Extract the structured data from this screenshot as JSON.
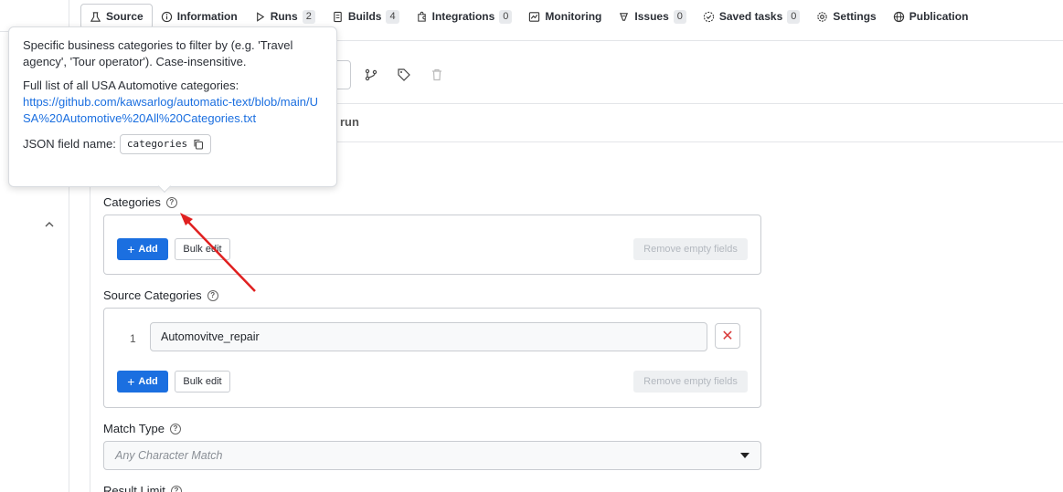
{
  "tabs": [
    {
      "label": "Source",
      "count": null,
      "icon": "source-icon"
    },
    {
      "label": "Information",
      "count": null,
      "icon": "info-icon"
    },
    {
      "label": "Runs",
      "count": "2",
      "icon": "play-icon"
    },
    {
      "label": "Builds",
      "count": "4",
      "icon": "builds-icon"
    },
    {
      "label": "Integrations",
      "count": "0",
      "icon": "puzzle-icon"
    },
    {
      "label": "Monitoring",
      "count": null,
      "icon": "chart-icon"
    },
    {
      "label": "Issues",
      "count": "0",
      "icon": "bug-icon"
    },
    {
      "label": "Saved tasks",
      "count": "0",
      "icon": "saved-tasks-icon"
    },
    {
      "label": "Settings",
      "count": null,
      "icon": "gear-icon"
    },
    {
      "label": "Publication",
      "count": null,
      "icon": "globe-icon"
    }
  ],
  "toolbar": {
    "run_text": "run"
  },
  "tooltip": {
    "description": "Specific business categories to filter by (e.g. 'Travel agency', 'Tour operator'). Case-insensitive.",
    "list_intro": "Full list of all USA Automotive categories:",
    "link": "https://github.com/kawsarlog/automatic-text/blob/main/USA%20Automotive%20All%20Categories.txt",
    "json_label": "JSON field name:",
    "json_field": "categories"
  },
  "form": {
    "categories": {
      "label": "Categories",
      "add_label": "Add",
      "bulk_label": "Bulk edit",
      "remove_label": "Remove empty fields"
    },
    "source_categories": {
      "label": "Source Categories",
      "items": [
        {
          "index": "1",
          "value": "Automovitve_repair"
        }
      ],
      "add_label": "Add",
      "bulk_label": "Bulk edit",
      "remove_label": "Remove empty fields"
    },
    "match_type": {
      "label": "Match Type",
      "placeholder": "Any Character Match"
    },
    "result_limit": {
      "label": "Result Limit"
    }
  },
  "colors": {
    "primary": "#1b6fe0",
    "annotation_arrow": "#e02020",
    "danger": "#d93b3b"
  }
}
